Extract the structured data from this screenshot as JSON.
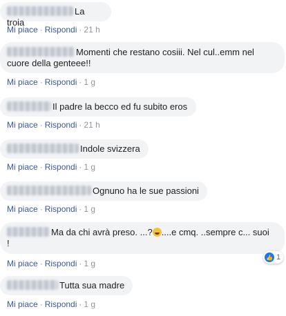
{
  "actions": {
    "like": "Mi piace",
    "reply": "Rispondi",
    "sep": "·"
  },
  "comments": [
    {
      "text": "La troia",
      "time": "21 h"
    },
    {
      "text_line1": "Momenti che restano cosiii. Nel cul..emm nel",
      "text_line2": "cuore della genteee!!",
      "time": "1 g"
    },
    {
      "text": "Il padre la becco ed fu subito eros",
      "time": "21 h"
    },
    {
      "text": "Indole svizzera",
      "time": "1 g"
    },
    {
      "text": "Ognuno ha le sue passioni",
      "time": "1 g"
    },
    {
      "text_part1": "Ma da chi avrà preso. ...?",
      "text_part2": "....e cmq. ..sempre c... suoi",
      "text_line2": "!",
      "time": "1 g",
      "reaction_count": "1"
    },
    {
      "text": "Tutta sua madre",
      "time": "1 g"
    }
  ],
  "icons": {
    "emoji": "grinning-sweat-emoji-icon",
    "reaction": "like-icon"
  },
  "colors": {
    "bubble": "#f2f3f5",
    "link": "#385898",
    "like_blue": "#1877f2"
  }
}
